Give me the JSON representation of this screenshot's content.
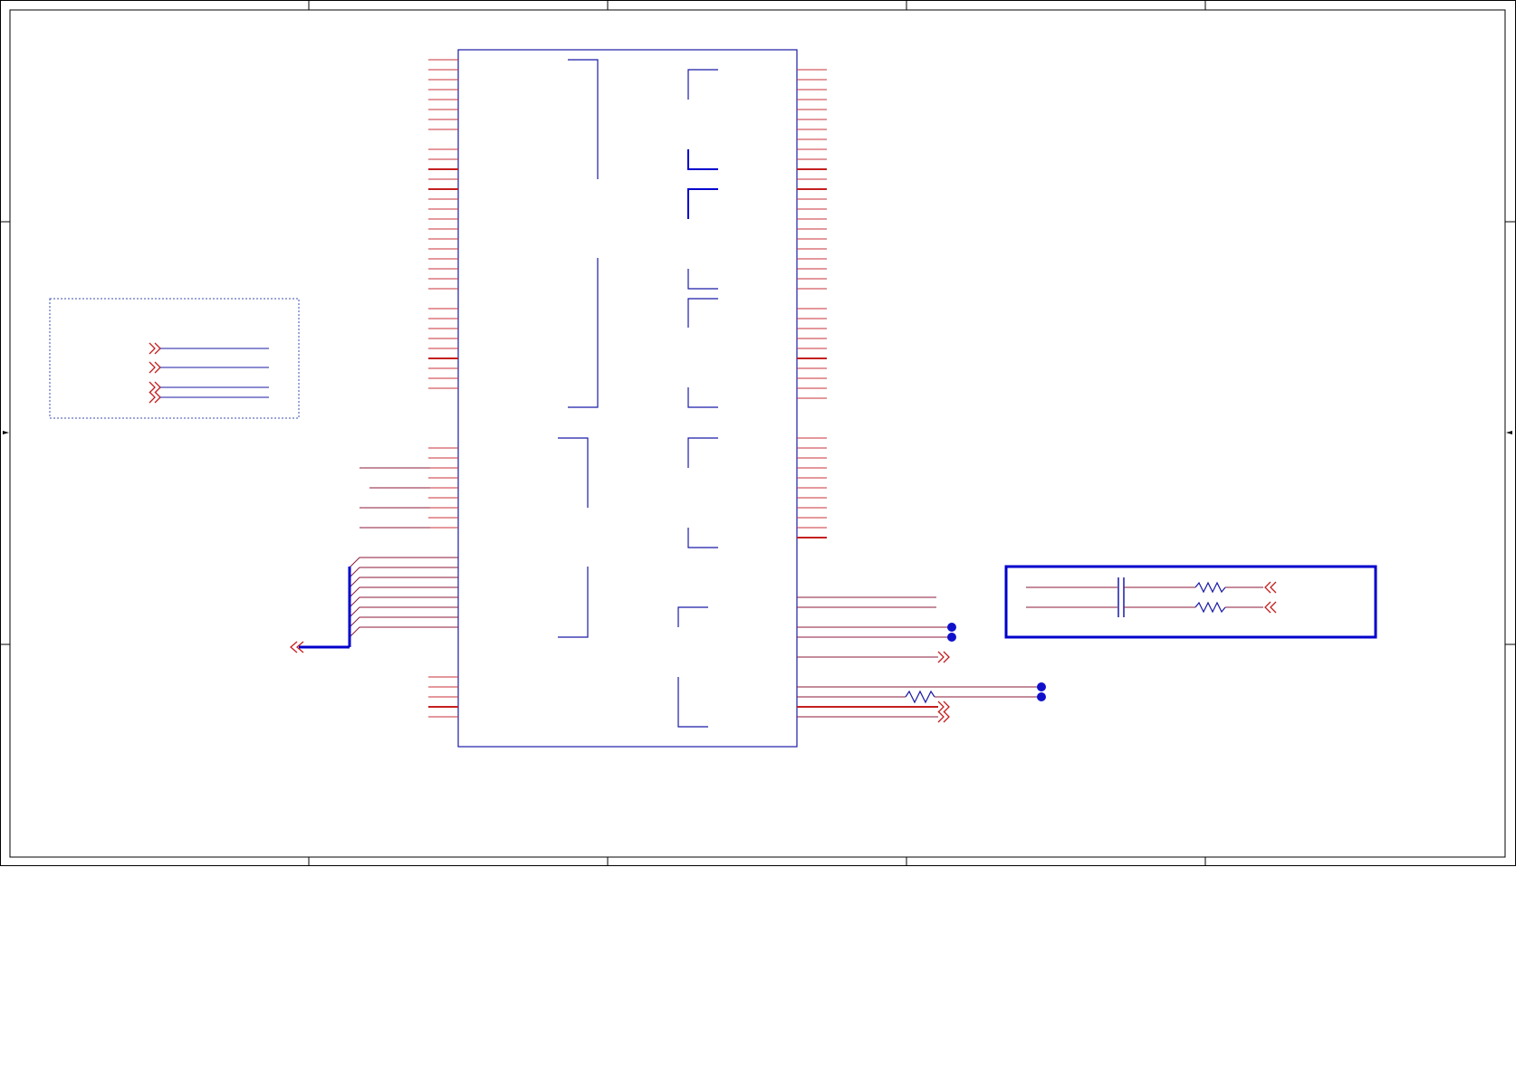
{
  "colors": {
    "frame": "#000000",
    "component": "#1a1aa6",
    "wire": "#c41e1e",
    "bus": "#0000cc",
    "junction": "#1010cc",
    "sub_box": "#3b4fb0",
    "background": "#ffffff"
  },
  "icons": {
    "offpage_right": "double-chevron-right-icon",
    "offpage_left": "double-chevron-left-icon",
    "junction": "junction-dot-icon",
    "resistor": "resistor-icon",
    "capacitor": "capacitor-icon"
  }
}
